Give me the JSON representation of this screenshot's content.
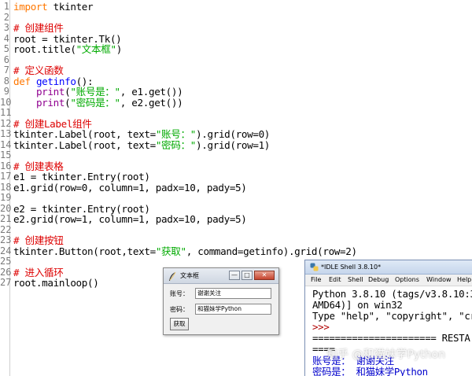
{
  "editor": {
    "lines": [
      {
        "n": "1",
        "segs": [
          {
            "c": "kw",
            "t": "import"
          },
          {
            "c": "plain",
            "t": " tkinter"
          }
        ]
      },
      {
        "n": "2",
        "segs": []
      },
      {
        "n": "3",
        "segs": [
          {
            "c": "cmt",
            "t": "# 创建组件"
          }
        ]
      },
      {
        "n": "4",
        "segs": [
          {
            "c": "plain",
            "t": "root = tkinter.Tk()"
          }
        ]
      },
      {
        "n": "5",
        "segs": [
          {
            "c": "plain",
            "t": "root.title("
          },
          {
            "c": "str",
            "t": "\"文本框\""
          },
          {
            "c": "plain",
            "t": ")"
          }
        ]
      },
      {
        "n": "6",
        "segs": []
      },
      {
        "n": "7",
        "segs": [
          {
            "c": "cmt",
            "t": "# 定义函数"
          }
        ]
      },
      {
        "n": "8",
        "segs": [
          {
            "c": "kw",
            "t": "def"
          },
          {
            "c": "plain",
            "t": " "
          },
          {
            "c": "def",
            "t": "getinfo"
          },
          {
            "c": "plain",
            "t": "():"
          }
        ]
      },
      {
        "n": "9",
        "segs": [
          {
            "c": "plain",
            "t": "    "
          },
          {
            "c": "bi",
            "t": "print"
          },
          {
            "c": "plain",
            "t": "("
          },
          {
            "c": "str",
            "t": "\"账号是：\""
          },
          {
            "c": "plain",
            "t": ", e1.get())"
          }
        ]
      },
      {
        "n": "10",
        "segs": [
          {
            "c": "plain",
            "t": "    "
          },
          {
            "c": "bi",
            "t": "print"
          },
          {
            "c": "plain",
            "t": "("
          },
          {
            "c": "str",
            "t": "\"密码是：\""
          },
          {
            "c": "plain",
            "t": ", e2.get())"
          }
        ]
      },
      {
        "n": "11",
        "segs": []
      },
      {
        "n": "12",
        "segs": [
          {
            "c": "cmt",
            "t": "# 创建Label组件"
          }
        ]
      },
      {
        "n": "13",
        "segs": [
          {
            "c": "plain",
            "t": "tkinter.Label(root, text="
          },
          {
            "c": "str",
            "t": "\"账号：\""
          },
          {
            "c": "plain",
            "t": ").grid(row=0)"
          }
        ]
      },
      {
        "n": "14",
        "segs": [
          {
            "c": "plain",
            "t": "tkinter.Label(root, text="
          },
          {
            "c": "str",
            "t": "\"密码：\""
          },
          {
            "c": "plain",
            "t": ").grid(row=1)"
          }
        ]
      },
      {
        "n": "15",
        "segs": []
      },
      {
        "n": "16",
        "segs": [
          {
            "c": "cmt",
            "t": "# 创建表格"
          }
        ]
      },
      {
        "n": "17",
        "segs": [
          {
            "c": "plain",
            "t": "e1 = tkinter.Entry(root)"
          }
        ]
      },
      {
        "n": "18",
        "segs": [
          {
            "c": "plain",
            "t": "e1.grid(row=0, column=1, padx=10, pady=5)"
          }
        ]
      },
      {
        "n": "19",
        "segs": []
      },
      {
        "n": "20",
        "segs": [
          {
            "c": "plain",
            "t": "e2 = tkinter.Entry(root)"
          }
        ]
      },
      {
        "n": "21",
        "segs": [
          {
            "c": "plain",
            "t": "e2.grid(row=1, column=1, padx=10, pady=5)"
          }
        ]
      },
      {
        "n": "22",
        "segs": []
      },
      {
        "n": "23",
        "segs": [
          {
            "c": "cmt",
            "t": "# 创建按钮"
          }
        ]
      },
      {
        "n": "24",
        "segs": [
          {
            "c": "plain",
            "t": "tkinter.Button(root,text="
          },
          {
            "c": "str",
            "t": "\"获取\""
          },
          {
            "c": "plain",
            "t": ", command=getinfo).grid(row=2)"
          }
        ]
      },
      {
        "n": "25",
        "segs": []
      },
      {
        "n": "26",
        "segs": [
          {
            "c": "cmt",
            "t": "# 进入循环"
          }
        ]
      },
      {
        "n": "27",
        "segs": [
          {
            "c": "plain",
            "t": "root.mainloop()"
          }
        ]
      }
    ]
  },
  "tk_window": {
    "title": "文本框",
    "min_glyph": "—",
    "max_glyph": "□",
    "close_glyph": "✕",
    "label_account": "账号：",
    "label_password": "密码：",
    "entry_account_value": "谢谢关注",
    "entry_password_value": "和猫妹学Python",
    "button_label": "获取"
  },
  "shell": {
    "title": "*IDLE Shell 3.8.10*",
    "menu": [
      "File",
      "Edit",
      "Shell",
      "Debug",
      "Options",
      "Window",
      "Help"
    ],
    "lines": [
      {
        "c": "out",
        "t": "Python 3.8.10 (tags/v3.8.10:3"
      },
      {
        "c": "out",
        "t": "AMD64)] on win32"
      },
      {
        "c": "out",
        "t": "Type \"help\", \"copyright\", \"cr"
      },
      {
        "c": "prompt",
        "t": ">>>"
      },
      {
        "c": "out",
        "t": "====================== RESTA"
      },
      {
        "c": "out",
        "t": "===="
      },
      {
        "c": "blue",
        "t": "账号是： 谢谢关注"
      },
      {
        "c": "blue",
        "t": "密码是： 和猫妹学Python"
      }
    ]
  },
  "watermark": "知乎 @和猫妹学Python"
}
